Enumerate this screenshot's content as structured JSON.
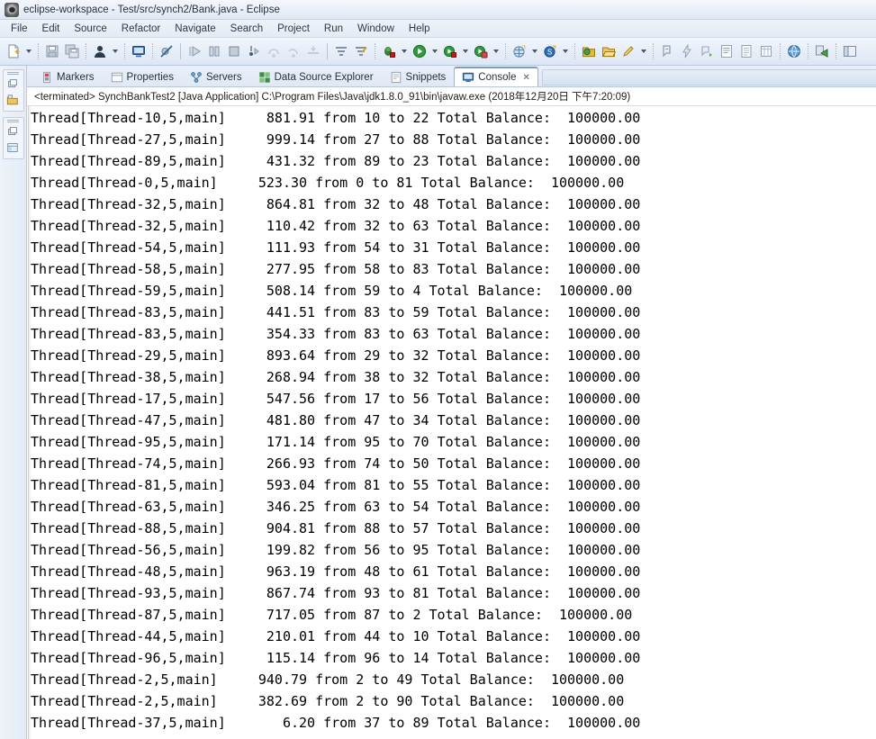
{
  "window": {
    "title": "eclipse-workspace - Test/src/synch2/Bank.java - Eclipse",
    "app_icon": "eclipse-icon"
  },
  "menubar": {
    "items": [
      {
        "label": "File"
      },
      {
        "label": "Edit"
      },
      {
        "label": "Source"
      },
      {
        "label": "Refactor"
      },
      {
        "label": "Navigate"
      },
      {
        "label": "Search"
      },
      {
        "label": "Project"
      },
      {
        "label": "Run"
      },
      {
        "label": "Window"
      },
      {
        "label": "Help"
      }
    ]
  },
  "toolbar": {
    "items": [
      {
        "icon": "new-file-icon",
        "type": "button"
      },
      {
        "type": "dropdown-arrow"
      },
      {
        "type": "separator-dotted"
      },
      {
        "icon": "save-icon",
        "type": "button"
      },
      {
        "icon": "save-all-icon",
        "type": "button"
      },
      {
        "type": "separator-dotted"
      },
      {
        "icon": "user-icon",
        "type": "button"
      },
      {
        "type": "dropdown-arrow"
      },
      {
        "type": "separator-dotted"
      },
      {
        "icon": "console-display-icon",
        "type": "button"
      },
      {
        "type": "separator-dotted"
      },
      {
        "icon": "skip-breakpoints-icon",
        "type": "button"
      },
      {
        "type": "separator-solid"
      },
      {
        "icon": "resume-icon",
        "type": "button"
      },
      {
        "icon": "suspend-icon",
        "type": "button"
      },
      {
        "icon": "terminate-icon",
        "type": "button"
      },
      {
        "icon": "step-into-icon",
        "type": "button"
      },
      {
        "icon": "step-over-icon",
        "type": "button"
      },
      {
        "icon": "step-return-icon",
        "type": "button"
      },
      {
        "icon": "drop-to-frame-icon",
        "type": "button"
      },
      {
        "type": "separator-solid"
      },
      {
        "icon": "toggle-stepfilter-icon",
        "type": "button"
      },
      {
        "icon": "use-stepfilter-icon",
        "type": "button"
      },
      {
        "type": "separator-dotted"
      },
      {
        "icon": "debug-bug-icon",
        "type": "button"
      },
      {
        "type": "dropdown-arrow"
      },
      {
        "icon": "run-green-icon",
        "type": "button"
      },
      {
        "type": "dropdown-arrow"
      },
      {
        "icon": "run-external-icon",
        "type": "button"
      },
      {
        "type": "dropdown-arrow"
      },
      {
        "icon": "run-coverage-icon",
        "type": "button"
      },
      {
        "type": "dropdown-arrow"
      },
      {
        "type": "separator-dotted"
      },
      {
        "icon": "new-java-project-icon",
        "type": "button"
      },
      {
        "type": "dropdown-arrow"
      },
      {
        "icon": "new-class-icon",
        "type": "button"
      },
      {
        "type": "dropdown-arrow"
      },
      {
        "type": "separator-dotted"
      },
      {
        "icon": "open-type-icon",
        "type": "button"
      },
      {
        "icon": "open-folder-icon",
        "type": "button"
      },
      {
        "icon": "search-pencil-icon",
        "type": "button"
      },
      {
        "type": "dropdown-arrow"
      },
      {
        "type": "separator-dotted"
      },
      {
        "icon": "annotation-icon",
        "type": "button"
      },
      {
        "icon": "quickfix-icon",
        "type": "button"
      },
      {
        "icon": "next-annotation-icon",
        "type": "button"
      },
      {
        "icon": "outline-list-icon",
        "type": "button"
      },
      {
        "icon": "document-icon",
        "type": "button"
      },
      {
        "icon": "table-icon",
        "type": "button"
      },
      {
        "type": "separator-dotted"
      },
      {
        "icon": "web-browser-icon",
        "type": "button"
      },
      {
        "type": "separator-dotted"
      },
      {
        "icon": "deploy-icon",
        "type": "button"
      },
      {
        "type": "separator-dotted"
      },
      {
        "icon": "perspective-icon",
        "type": "button"
      }
    ]
  },
  "fastview": {
    "groups": [
      {
        "restore_icon": "restore-view-icon",
        "view_icon": "package-explorer-icon"
      },
      {
        "restore_icon": "restore-view-icon",
        "view_icon": "outline-view-icon"
      }
    ]
  },
  "view_tabs": {
    "items": [
      {
        "label": "Markers",
        "icon": "markers-icon",
        "active": false
      },
      {
        "label": "Properties",
        "icon": "properties-icon",
        "active": false
      },
      {
        "label": "Servers",
        "icon": "servers-icon",
        "active": false
      },
      {
        "label": "Data Source Explorer",
        "icon": "data-source-explorer-icon",
        "active": false
      },
      {
        "label": "Snippets",
        "icon": "snippets-icon",
        "active": false
      },
      {
        "label": "Console",
        "icon": "console-icon",
        "active": true
      }
    ],
    "close_glyph": "✕"
  },
  "console": {
    "launch_line": "<terminated> SynchBankTest2 [Java Application] C:\\Program Files\\Java\\jdk1.8.0_91\\bin\\javaw.exe (2018年12月20日 下午7:20:09)",
    "lines": [
      "Thread[Thread-10,5,main]     881.91 from 10 to 22 Total Balance:  100000.00",
      "Thread[Thread-27,5,main]     999.14 from 27 to 88 Total Balance:  100000.00",
      "Thread[Thread-89,5,main]     431.32 from 89 to 23 Total Balance:  100000.00",
      "Thread[Thread-0,5,main]     523.30 from 0 to 81 Total Balance:  100000.00",
      "Thread[Thread-32,5,main]     864.81 from 32 to 48 Total Balance:  100000.00",
      "Thread[Thread-32,5,main]     110.42 from 32 to 63 Total Balance:  100000.00",
      "Thread[Thread-54,5,main]     111.93 from 54 to 31 Total Balance:  100000.00",
      "Thread[Thread-58,5,main]     277.95 from 58 to 83 Total Balance:  100000.00",
      "Thread[Thread-59,5,main]     508.14 from 59 to 4 Total Balance:  100000.00",
      "Thread[Thread-83,5,main]     441.51 from 83 to 59 Total Balance:  100000.00",
      "Thread[Thread-83,5,main]     354.33 from 83 to 63 Total Balance:  100000.00",
      "Thread[Thread-29,5,main]     893.64 from 29 to 32 Total Balance:  100000.00",
      "Thread[Thread-38,5,main]     268.94 from 38 to 32 Total Balance:  100000.00",
      "Thread[Thread-17,5,main]     547.56 from 17 to 56 Total Balance:  100000.00",
      "Thread[Thread-47,5,main]     481.80 from 47 to 34 Total Balance:  100000.00",
      "Thread[Thread-95,5,main]     171.14 from 95 to 70 Total Balance:  100000.00",
      "Thread[Thread-74,5,main]     266.93 from 74 to 50 Total Balance:  100000.00",
      "Thread[Thread-81,5,main]     593.04 from 81 to 55 Total Balance:  100000.00",
      "Thread[Thread-63,5,main]     346.25 from 63 to 54 Total Balance:  100000.00",
      "Thread[Thread-88,5,main]     904.81 from 88 to 57 Total Balance:  100000.00",
      "Thread[Thread-56,5,main]     199.82 from 56 to 95 Total Balance:  100000.00",
      "Thread[Thread-48,5,main]     963.19 from 48 to 61 Total Balance:  100000.00",
      "Thread[Thread-93,5,main]     867.74 from 93 to 81 Total Balance:  100000.00",
      "Thread[Thread-87,5,main]     717.05 from 87 to 2 Total Balance:  100000.00",
      "Thread[Thread-44,5,main]     210.01 from 44 to 10 Total Balance:  100000.00",
      "Thread[Thread-96,5,main]     115.14 from 96 to 14 Total Balance:  100000.00",
      "Thread[Thread-2,5,main]     940.79 from 2 to 49 Total Balance:  100000.00",
      "Thread[Thread-2,5,main]     382.69 from 2 to 90 Total Balance:  100000.00",
      "Thread[Thread-37,5,main]       6.20 from 37 to 89 Total Balance:  100000.00"
    ]
  },
  "colors": {
    "titlebar_gradient_top": "#f4f7fc",
    "titlebar_gradient_bottom": "#dfe8f4",
    "toolbar_bg": "#e6eef8",
    "console_bg": "#ffffff",
    "console_text": "#000000",
    "tab_active_bg": "#ffffff",
    "accent_border": "#7a9cc6"
  }
}
